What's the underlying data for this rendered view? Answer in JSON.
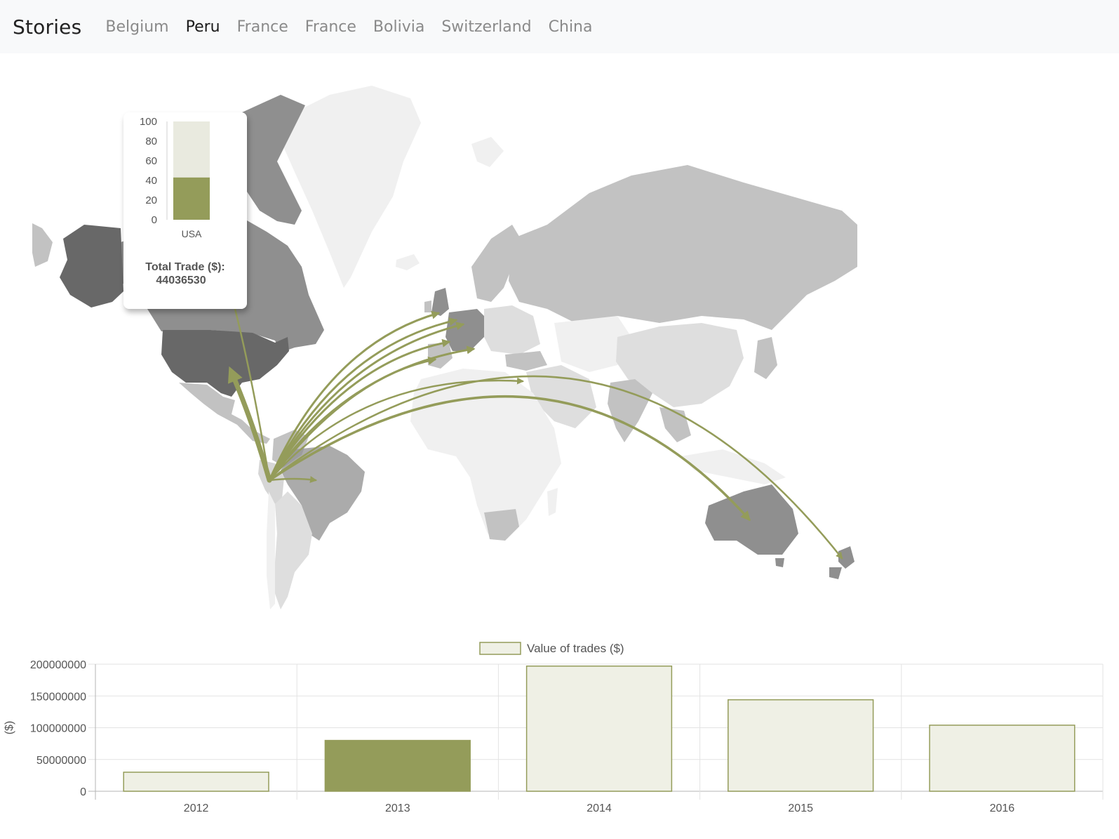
{
  "navbar": {
    "brand": "Stories",
    "items": [
      {
        "label": "Belgium",
        "active": false
      },
      {
        "label": "Peru",
        "active": true
      },
      {
        "label": "France",
        "active": false
      },
      {
        "label": "France",
        "active": false
      },
      {
        "label": "Bolivia",
        "active": false
      },
      {
        "label": "Switzerland",
        "active": false
      },
      {
        "label": "China",
        "active": false
      }
    ]
  },
  "colors": {
    "accent": "#949c5a",
    "accent_light": "#eff0e5",
    "navbar_bg": "#f8f9fa",
    "country_dark": "#686868",
    "country_mid": "#8f8f8f",
    "country_light": "#c2c2c2",
    "country_lighter": "#dedede",
    "country_lightest": "#f0f0f0"
  },
  "map": {
    "origin": "Peru",
    "trade_routes": [
      {
        "to": "USA",
        "highlighted": true
      },
      {
        "to": "United Kingdom"
      },
      {
        "to": "Netherlands"
      },
      {
        "to": "Belgium"
      },
      {
        "to": "Germany"
      },
      {
        "to": "France"
      },
      {
        "to": "Switzerland"
      },
      {
        "to": "Spain"
      },
      {
        "to": "Israel"
      },
      {
        "to": "Australia"
      },
      {
        "to": "New Zealand"
      },
      {
        "to": "Brazil"
      }
    ]
  },
  "tooltip": {
    "chart_data": {
      "type": "bar",
      "categories": [
        "USA"
      ],
      "values": [
        43
      ],
      "ylim": [
        0,
        100
      ],
      "yticks": [
        0,
        20,
        40,
        60,
        80,
        100
      ]
    },
    "total_label": "Total Trade ($):",
    "total_value": "44036530"
  },
  "chart_data": {
    "type": "bar",
    "categories": [
      "2012",
      "2013",
      "2014",
      "2015",
      "2016"
    ],
    "series": [
      {
        "name": "Value of trades ($)",
        "values": [
          30000000,
          80000000,
          197000000,
          144000000,
          104000000
        ]
      }
    ],
    "highlighted_category": "2013",
    "ylabel": "($)",
    "ylim": [
      0,
      200000000
    ],
    "yticks": [
      0,
      50000000,
      100000000,
      150000000,
      200000000
    ],
    "grid": true,
    "legend": "top"
  }
}
